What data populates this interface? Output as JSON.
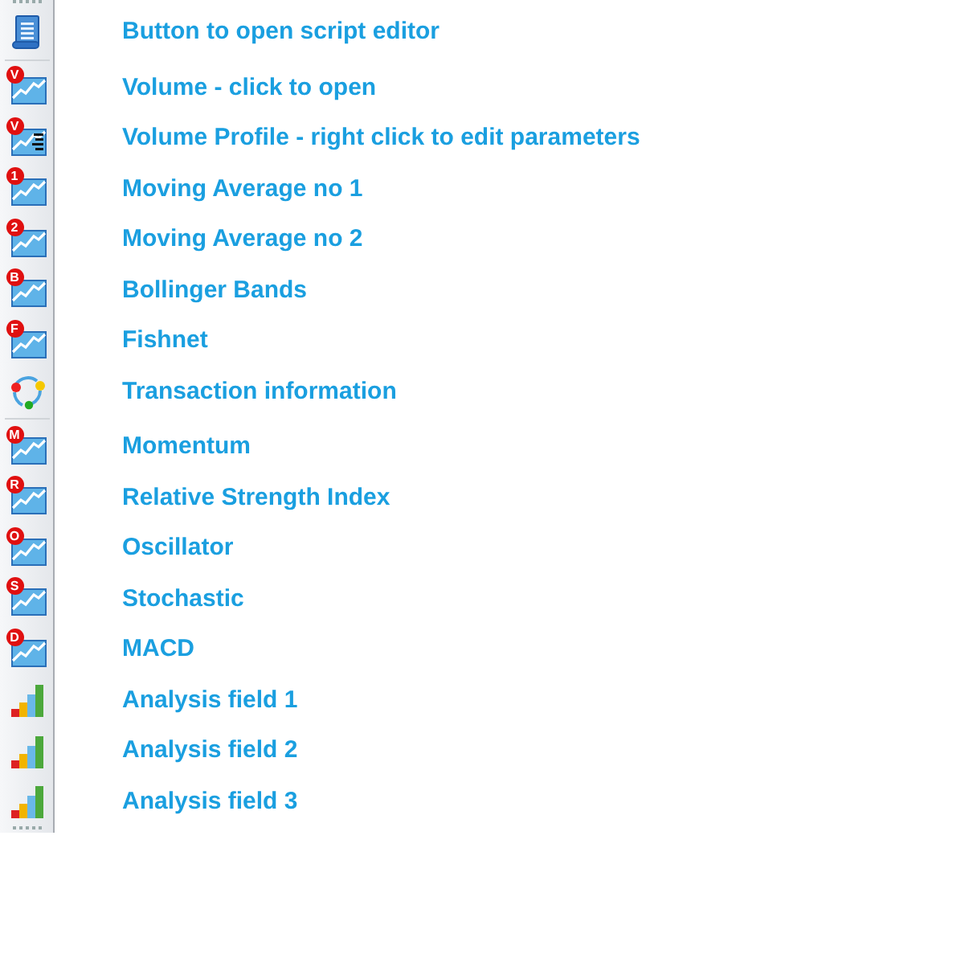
{
  "toolbar": [
    {
      "kind": "script",
      "label": "Button to open script editor",
      "separator_after": true
    },
    {
      "kind": "chart",
      "badge": "V",
      "label": "Volume - click to open"
    },
    {
      "kind": "profile",
      "badge": "V",
      "label": "Volume Profile - right click to edit parameters"
    },
    {
      "kind": "chart",
      "badge": "1",
      "label": "Moving Average no 1"
    },
    {
      "kind": "chart",
      "badge": "2",
      "label": "Moving Average no 2"
    },
    {
      "kind": "chart",
      "badge": "B",
      "label": "Bollinger Bands"
    },
    {
      "kind": "chart",
      "badge": "F",
      "label": "Fishnet"
    },
    {
      "kind": "transaction",
      "label": "Transaction information",
      "separator_after": true
    },
    {
      "kind": "chart",
      "badge": "M",
      "label": "Momentum"
    },
    {
      "kind": "chart",
      "badge": "R",
      "label": "Relative Strength Index"
    },
    {
      "kind": "chart",
      "badge": "O",
      "label": "Oscillator"
    },
    {
      "kind": "chart",
      "badge": "S",
      "label": "Stochastic"
    },
    {
      "kind": "chart",
      "badge": "D",
      "label": "MACD"
    },
    {
      "kind": "bars",
      "label": "Analysis field 1"
    },
    {
      "kind": "bars",
      "label": "Analysis field 2"
    },
    {
      "kind": "bars",
      "label": "Analysis field 3"
    }
  ]
}
